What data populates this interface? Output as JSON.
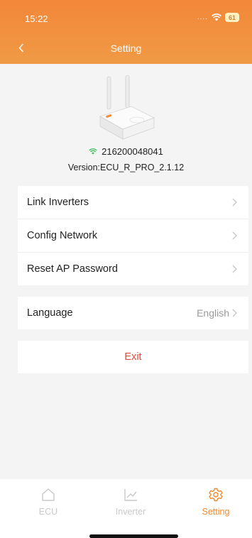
{
  "status_bar": {
    "time": "15:22",
    "signal": "....",
    "battery": "61"
  },
  "header": {
    "title": "Setting"
  },
  "device": {
    "serial": "216200048041",
    "version": "Version:ECU_R_PRO_2.1.12"
  },
  "menu": {
    "items": [
      {
        "label": "Link Inverters"
      },
      {
        "label": "Config Network"
      },
      {
        "label": "Reset AP Password"
      }
    ],
    "language": {
      "label": "Language",
      "value": "English"
    }
  },
  "exit_label": "Exit",
  "tabbar": {
    "tabs": [
      {
        "label": "ECU",
        "icon": "home-icon"
      },
      {
        "label": "Inverter",
        "icon": "chart-icon"
      },
      {
        "label": "Setting",
        "icon": "gear-icon"
      }
    ],
    "active": "Setting"
  },
  "colors": {
    "accent": "#f08a35",
    "exit": "#e8473d",
    "inactive": "#c9c9c9"
  }
}
